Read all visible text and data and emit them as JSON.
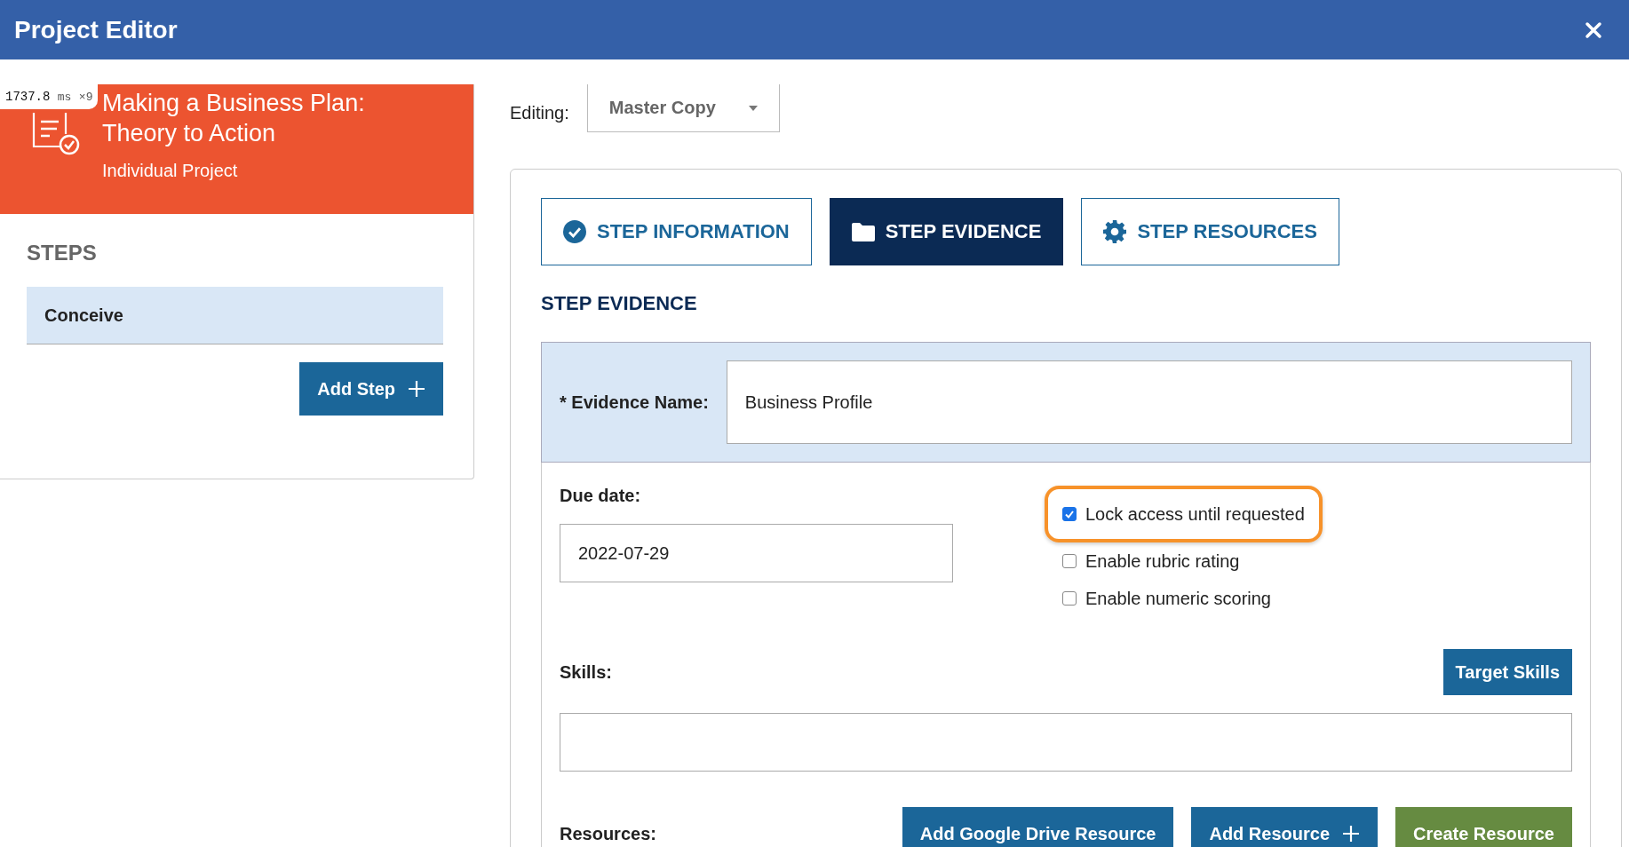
{
  "window": {
    "title": "Project Editor"
  },
  "timing_badge": {
    "value": "1737.8",
    "unit": "ms",
    "count": "×9"
  },
  "project": {
    "title": "Making a Business Plan: Theory to Action",
    "subtitle": "Individual Project"
  },
  "steps": {
    "heading": "STEPS",
    "items": [
      {
        "label": "Conceive",
        "selected": true
      }
    ],
    "add_button": "Add Step"
  },
  "editing": {
    "label": "Editing:",
    "value": "Master Copy"
  },
  "tabs": [
    {
      "label": "STEP INFORMATION",
      "selected": false
    },
    {
      "label": "STEP EVIDENCE",
      "selected": true
    },
    {
      "label": "STEP RESOURCES",
      "selected": false
    }
  ],
  "section_heading": "STEP EVIDENCE",
  "evidence_name": {
    "label": "* Evidence Name:",
    "value": "Business Profile"
  },
  "due_date": {
    "label": "Due date:",
    "value": "2022-07-29"
  },
  "options": [
    {
      "label": "Lock access until requested",
      "checked": true,
      "highlighted": true
    },
    {
      "label": "Enable rubric rating",
      "checked": false,
      "highlighted": false
    },
    {
      "label": "Enable numeric scoring",
      "checked": false,
      "highlighted": false
    }
  ],
  "skills": {
    "label": "Skills:",
    "button": "Target Skills"
  },
  "resources": {
    "label": "Resources:",
    "buttons": [
      {
        "label": "Add Google Drive Resource",
        "kind": "primary",
        "plus": false
      },
      {
        "label": "Add Resource",
        "kind": "primary",
        "plus": true
      },
      {
        "label": "Create Resource",
        "kind": "success",
        "plus": false
      }
    ]
  }
}
